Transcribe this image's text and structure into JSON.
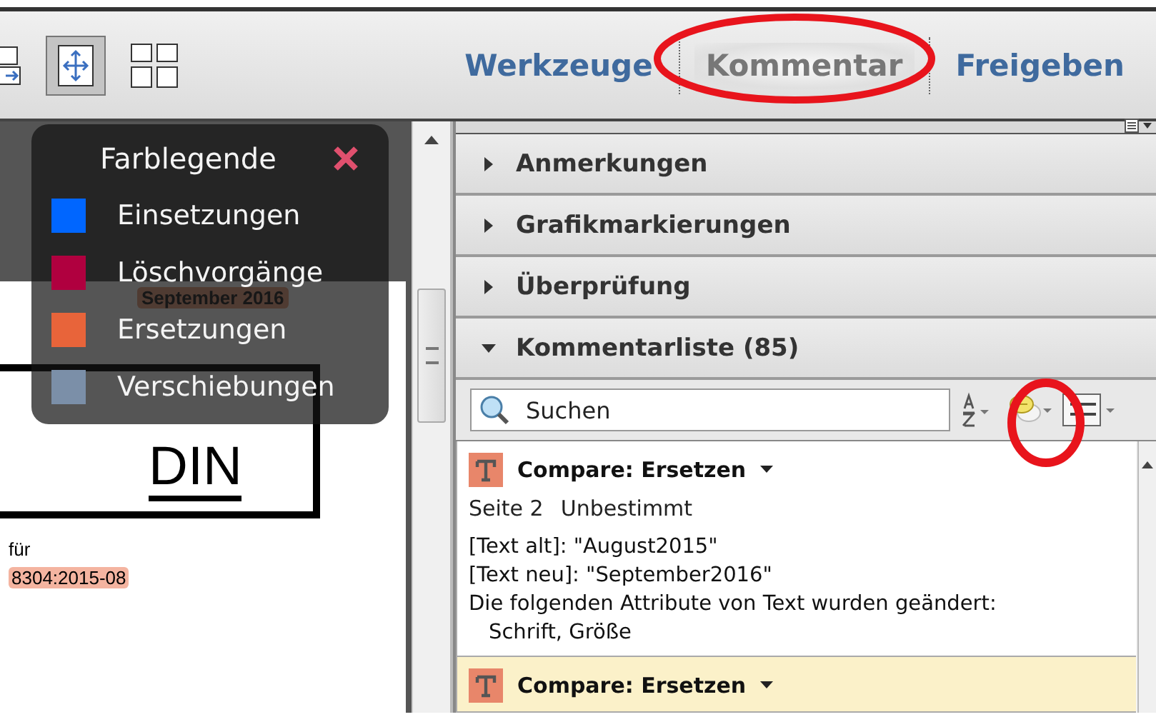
{
  "toolbar": {
    "tabs": [
      {
        "label": "Werkzeuge",
        "selected": false
      },
      {
        "label": "Kommentar",
        "selected": true
      },
      {
        "label": "Freigeben",
        "selected": false
      }
    ]
  },
  "legend": {
    "title": "Farblegende",
    "items": [
      {
        "label": "Einsetzungen",
        "color": "#0066ff"
      },
      {
        "label": "Löschvorgänge",
        "color": "#b0003f"
      },
      {
        "label": "Ersetzungen",
        "color": "#e8643a"
      },
      {
        "label": "Verschiebungen",
        "color": "#7b8fa8"
      }
    ]
  },
  "document": {
    "highlight": "September 2016",
    "heading": "DIN",
    "word": "für",
    "reference": "8304:2015-08"
  },
  "panel": {
    "sections": [
      {
        "label": "Anmerkungen",
        "expanded": false
      },
      {
        "label": "Grafikmarkierungen",
        "expanded": false
      },
      {
        "label": "Überprüfung",
        "expanded": false
      },
      {
        "label": "Kommentarliste (85)",
        "expanded": true
      }
    ],
    "search": {
      "placeholder": "Suchen"
    },
    "comments": [
      {
        "type": "Compare: Ersetzen",
        "selected": false,
        "page": "Seite 2",
        "status": "Unbestimmt",
        "lines": [
          "[Text alt]: \"August2015\"",
          "[Text neu]: \"September2016\"",
          "Die folgenden Attribute von Text wurden geändert:"
        ],
        "attributes": "Schrift, Größe"
      },
      {
        "type": "Compare: Ersetzen",
        "selected": true
      }
    ]
  }
}
